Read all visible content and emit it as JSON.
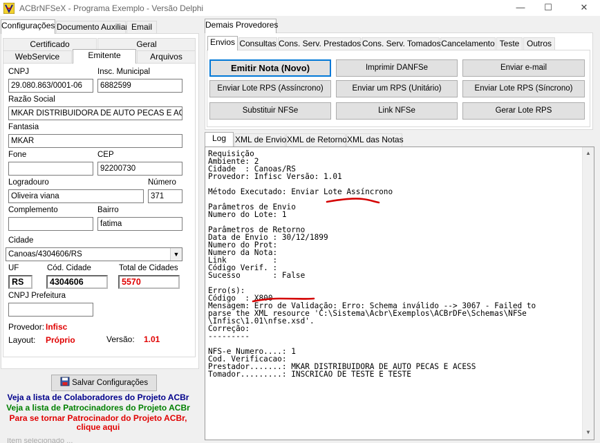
{
  "window": {
    "title": "ACBrNFSeX - Programa Exemplo - Versão Delphi",
    "minimize": "—",
    "maximize": "☐",
    "close": "✕"
  },
  "left_tabs": [
    "Configurações",
    "Documento Auxiliar",
    "Email"
  ],
  "sub_tabs_row1": [
    "Certificado",
    "Geral"
  ],
  "sub_tabs_row2": [
    "WebService",
    "Emitente",
    "Arquivos"
  ],
  "emitente": {
    "cnpj_label": "CNPJ",
    "cnpj": "29.080.863/0001-06",
    "im_label": "Insc. Municipal",
    "im": "6882599",
    "razao_label": "Razão Social",
    "razao": "MKAR DISTRIBUIDORA DE AUTO PECAS E ACESS",
    "fantasia_label": "Fantasia",
    "fantasia": "MKAR",
    "fone_label": "Fone",
    "fone": "",
    "cep_label": "CEP",
    "cep": "92200730",
    "logradouro_label": "Logradouro",
    "logradouro": "Oliveira viana",
    "numero_label": "Número",
    "numero": "371",
    "complemento_label": "Complemento",
    "complemento": "",
    "bairro_label": "Bairro",
    "bairro": "fatima",
    "cidade_label": "Cidade",
    "cidade": "Canoas/4304606/RS",
    "uf_label": "UF",
    "uf": "RS",
    "cod_cidade_label": "Cód. Cidade",
    "cod_cidade": "4304606",
    "total_cidades_label": "Total de Cidades",
    "total_cidades": "5570",
    "cnpj_pref_label": "CNPJ Prefeitura",
    "cnpj_pref": "",
    "provedor_label": "Provedor:",
    "provedor": "Infisc",
    "layout_label": "Layout:",
    "layout": "Próprio",
    "versao_label": "Versão:",
    "versao": "1.01"
  },
  "save_button": "Salvar Configurações",
  "links": {
    "colaboradores": "Veja a lista de Colaboradores do Projeto ACBr",
    "patrocinadores": "Veja a lista de Patrocinadores do Projeto ACBr",
    "patrocinador_l1": "Para se tornar Patrocinador do Projeto ACBr,",
    "patrocinador_l2": "clique aqui",
    "colors": {
      "blue": "#00008b",
      "green": "#008000",
      "red": "#e00000"
    }
  },
  "statusbar_fragment": "Item selecionado ...",
  "right_top_tab": "Demais Provedores",
  "op_tabs": [
    "Envios",
    "Consultas",
    "Cons. Serv. Prestados",
    "Cons. Serv. Tomados",
    "Cancelamento",
    "Teste",
    "Outros"
  ],
  "buttons": {
    "emitir": "Emitir Nota (Novo)",
    "danfse": "Imprimir DANFSe",
    "email": "Enviar e-mail",
    "lote_assinc": "Enviar Lote RPS (Assíncrono)",
    "rps_unit": "Enviar um RPS (Unitário)",
    "lote_sinc": "Enviar Lote RPS (Síncrono)",
    "substituir": "Substituir NFSe",
    "link": "Link NFSe",
    "gerar_lote": "Gerar Lote RPS"
  },
  "log_tabs": [
    "Log",
    "XML de Envio",
    "XML de Retorno",
    "XML das Notas"
  ],
  "log_lines": [
    "Requisição",
    "Ambiente: 2",
    "Cidade  : Canoas/RS",
    "Provedor: Infisc Versão: 1.01",
    "",
    "Método Executado: Enviar Lote Assíncrono",
    "",
    "Parâmetros de Envio",
    "Numero do Lote: 1",
    "",
    "Parâmetros de Retorno",
    "Data de Envio : 30/12/1899",
    "Numero do Prot:",
    "Numero da Nota:",
    "Link          :",
    "Código Verif. :",
    "Sucesso       : False",
    "",
    "Erro(s):",
    "Código  : X800",
    "Mensagem: Erro de Validação: Erro: Schema inválido --> 3067 - Failed to",
    "parse the XML resource 'C:\\Sistema\\Acbr\\Exemplos\\ACBrDFe\\Schemas\\NFSe",
    "\\Infisc\\1.01\\nfse.xsd'.",
    "Correção:",
    "---------",
    "",
    "NFS-e Numero....: 1",
    "Cod. Verificacao:",
    "Prestador.......: MKAR DISTRIBUIDORA DE AUTO PECAS E ACESS",
    "Tomador.........: INSCRICAO DE TESTE E TESTE"
  ]
}
